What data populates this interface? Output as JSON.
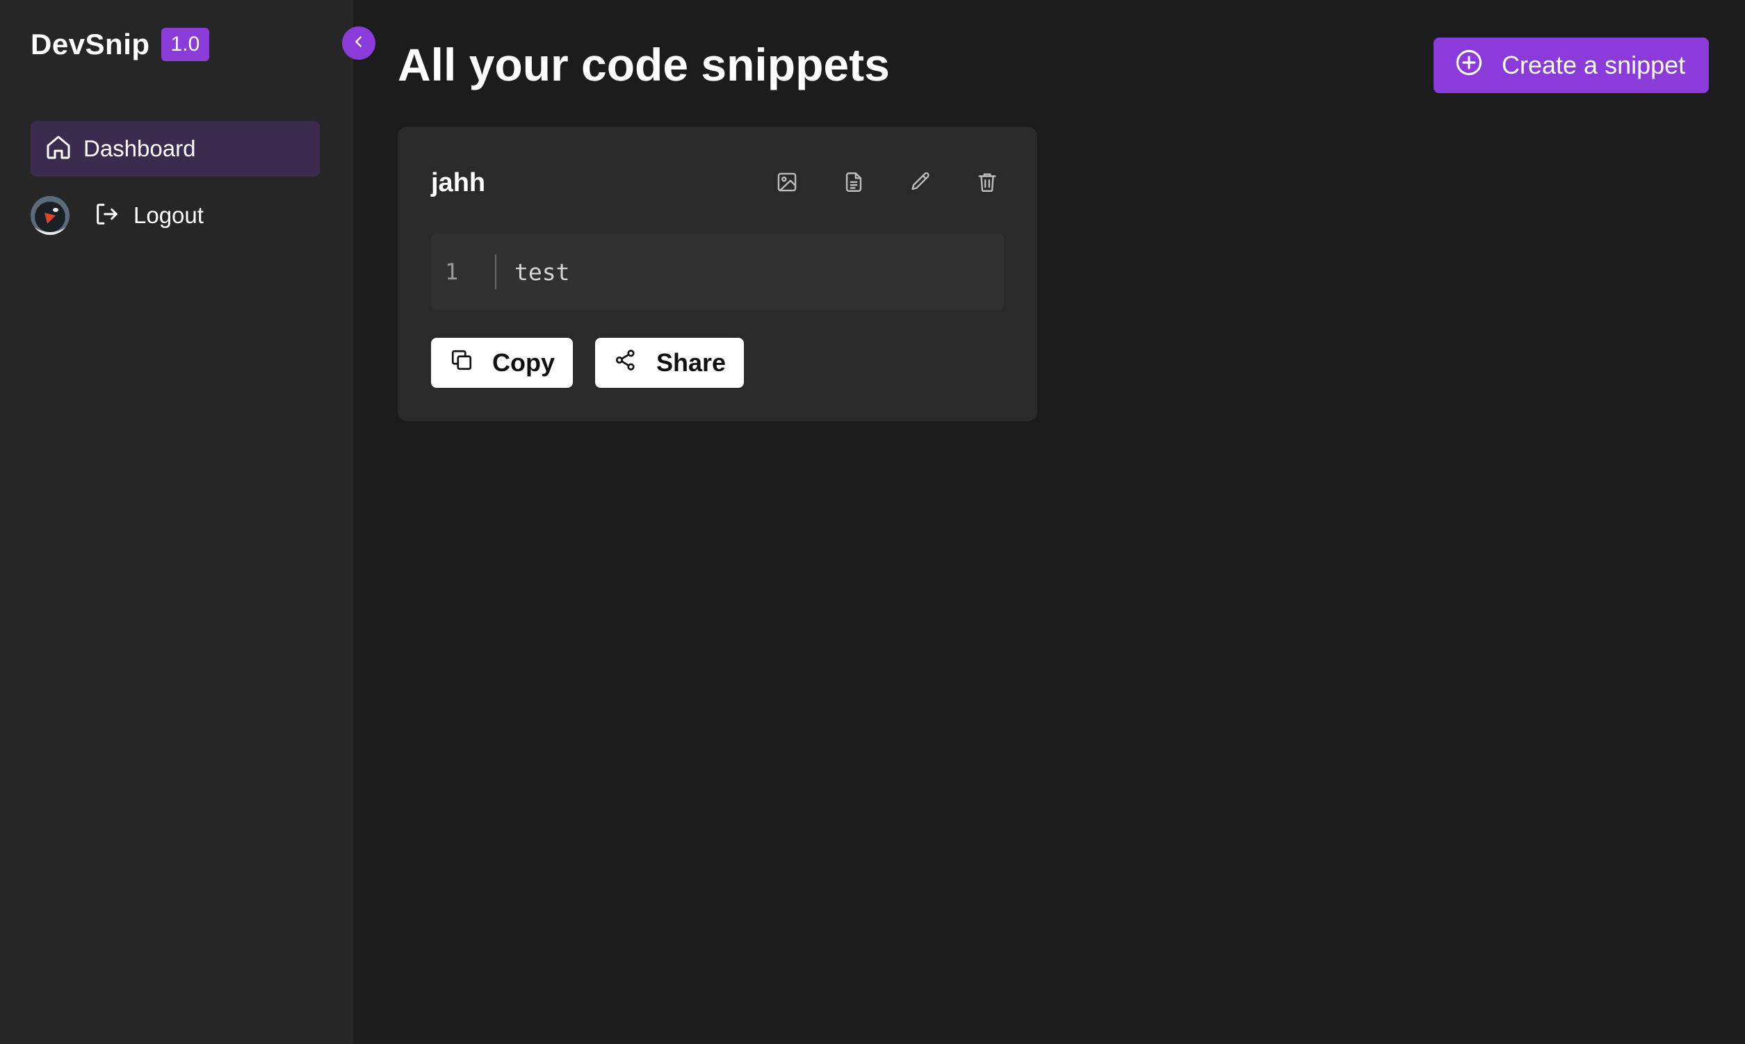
{
  "brand": {
    "name": "DevSnip",
    "version": "1.0"
  },
  "sidebar": {
    "nav": [
      {
        "label": "Dashboard",
        "icon": "home-icon",
        "active": true
      }
    ],
    "logout_label": "Logout"
  },
  "main": {
    "title": "All your code snippets",
    "create_label": "Create a snippet"
  },
  "snippets": [
    {
      "title": "jahh",
      "lines": [
        {
          "number": "1",
          "text": "test"
        }
      ],
      "copy_label": "Copy",
      "share_label": "Share"
    }
  ],
  "colors": {
    "accent": "#8a3bd9",
    "sidebar_bg": "#262626",
    "main_bg": "#1c1c1c",
    "card_bg": "#2a2a2a",
    "active_nav_bg": "#3b2c4f"
  }
}
